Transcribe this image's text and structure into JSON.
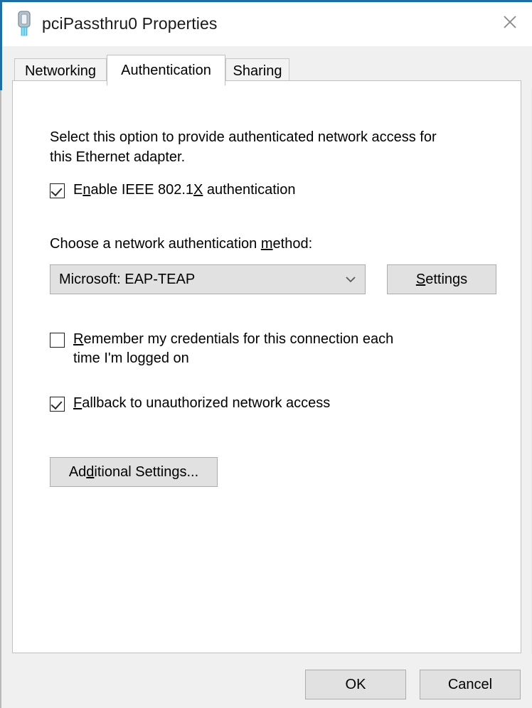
{
  "window": {
    "title": "pciPassthru0 Properties",
    "icon": "network-adapter-icon",
    "close_icon": "close-icon",
    "accent_color": "#1c6ea4",
    "titlebar_bg": "#ffffff",
    "dialog_bg": "#f0f0f0",
    "panel_bg": "#ffffff"
  },
  "tabs": [
    {
      "label": "Networking",
      "active": false
    },
    {
      "label": "Authentication",
      "active": true
    },
    {
      "label": "Sharing",
      "active": false
    }
  ],
  "content": {
    "intro_line1": "Select this option to provide authenticated network access for",
    "intro_line2": "this Ethernet adapter.",
    "enable_8021x": {
      "label_pre": "E",
      "label_accel": "n",
      "label_post": "able IEEE 802.1",
      "label_accel2": "X",
      "label_tail": " authentication",
      "checked": true
    },
    "method_label_pre": "Choose a network authentication ",
    "method_label_accel": "m",
    "method_label_post": "ethod:",
    "method_combo": {
      "value": "Microsoft: EAP-TEAP",
      "arrow_icon": "chevron-down-icon"
    },
    "settings_button": {
      "accel": "S",
      "rest": "ettings"
    },
    "remember_credentials": {
      "accel": "R",
      "rest": "emember my credentials for this connection each",
      "line2": "time I'm logged on",
      "checked": false
    },
    "fallback": {
      "accel": "F",
      "rest": "allback to unauthorized network access",
      "checked": true
    },
    "additional_settings_button": {
      "pre": "Ad",
      "accel": "d",
      "post": "itional Settings..."
    }
  },
  "footer": {
    "ok_label": "OK",
    "cancel_label": "Cancel"
  }
}
